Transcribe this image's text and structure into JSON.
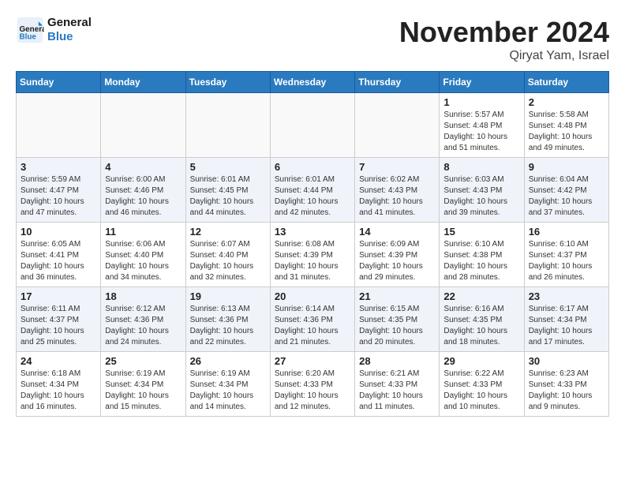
{
  "header": {
    "logo_line1": "General",
    "logo_line2": "Blue",
    "month": "November 2024",
    "location": "Qiryat Yam, Israel"
  },
  "weekdays": [
    "Sunday",
    "Monday",
    "Tuesday",
    "Wednesday",
    "Thursday",
    "Friday",
    "Saturday"
  ],
  "weeks": [
    [
      {
        "day": "",
        "content": ""
      },
      {
        "day": "",
        "content": ""
      },
      {
        "day": "",
        "content": ""
      },
      {
        "day": "",
        "content": ""
      },
      {
        "day": "",
        "content": ""
      },
      {
        "day": "1",
        "content": "Sunrise: 5:57 AM\nSunset: 4:48 PM\nDaylight: 10 hours\nand 51 minutes."
      },
      {
        "day": "2",
        "content": "Sunrise: 5:58 AM\nSunset: 4:48 PM\nDaylight: 10 hours\nand 49 minutes."
      }
    ],
    [
      {
        "day": "3",
        "content": "Sunrise: 5:59 AM\nSunset: 4:47 PM\nDaylight: 10 hours\nand 47 minutes."
      },
      {
        "day": "4",
        "content": "Sunrise: 6:00 AM\nSunset: 4:46 PM\nDaylight: 10 hours\nand 46 minutes."
      },
      {
        "day": "5",
        "content": "Sunrise: 6:01 AM\nSunset: 4:45 PM\nDaylight: 10 hours\nand 44 minutes."
      },
      {
        "day": "6",
        "content": "Sunrise: 6:01 AM\nSunset: 4:44 PM\nDaylight: 10 hours\nand 42 minutes."
      },
      {
        "day": "7",
        "content": "Sunrise: 6:02 AM\nSunset: 4:43 PM\nDaylight: 10 hours\nand 41 minutes."
      },
      {
        "day": "8",
        "content": "Sunrise: 6:03 AM\nSunset: 4:43 PM\nDaylight: 10 hours\nand 39 minutes."
      },
      {
        "day": "9",
        "content": "Sunrise: 6:04 AM\nSunset: 4:42 PM\nDaylight: 10 hours\nand 37 minutes."
      }
    ],
    [
      {
        "day": "10",
        "content": "Sunrise: 6:05 AM\nSunset: 4:41 PM\nDaylight: 10 hours\nand 36 minutes."
      },
      {
        "day": "11",
        "content": "Sunrise: 6:06 AM\nSunset: 4:40 PM\nDaylight: 10 hours\nand 34 minutes."
      },
      {
        "day": "12",
        "content": "Sunrise: 6:07 AM\nSunset: 4:40 PM\nDaylight: 10 hours\nand 32 minutes."
      },
      {
        "day": "13",
        "content": "Sunrise: 6:08 AM\nSunset: 4:39 PM\nDaylight: 10 hours\nand 31 minutes."
      },
      {
        "day": "14",
        "content": "Sunrise: 6:09 AM\nSunset: 4:39 PM\nDaylight: 10 hours\nand 29 minutes."
      },
      {
        "day": "15",
        "content": "Sunrise: 6:10 AM\nSunset: 4:38 PM\nDaylight: 10 hours\nand 28 minutes."
      },
      {
        "day": "16",
        "content": "Sunrise: 6:10 AM\nSunset: 4:37 PM\nDaylight: 10 hours\nand 26 minutes."
      }
    ],
    [
      {
        "day": "17",
        "content": "Sunrise: 6:11 AM\nSunset: 4:37 PM\nDaylight: 10 hours\nand 25 minutes."
      },
      {
        "day": "18",
        "content": "Sunrise: 6:12 AM\nSunset: 4:36 PM\nDaylight: 10 hours\nand 24 minutes."
      },
      {
        "day": "19",
        "content": "Sunrise: 6:13 AM\nSunset: 4:36 PM\nDaylight: 10 hours\nand 22 minutes."
      },
      {
        "day": "20",
        "content": "Sunrise: 6:14 AM\nSunset: 4:36 PM\nDaylight: 10 hours\nand 21 minutes."
      },
      {
        "day": "21",
        "content": "Sunrise: 6:15 AM\nSunset: 4:35 PM\nDaylight: 10 hours\nand 20 minutes."
      },
      {
        "day": "22",
        "content": "Sunrise: 6:16 AM\nSunset: 4:35 PM\nDaylight: 10 hours\nand 18 minutes."
      },
      {
        "day": "23",
        "content": "Sunrise: 6:17 AM\nSunset: 4:34 PM\nDaylight: 10 hours\nand 17 minutes."
      }
    ],
    [
      {
        "day": "24",
        "content": "Sunrise: 6:18 AM\nSunset: 4:34 PM\nDaylight: 10 hours\nand 16 minutes."
      },
      {
        "day": "25",
        "content": "Sunrise: 6:19 AM\nSunset: 4:34 PM\nDaylight: 10 hours\nand 15 minutes."
      },
      {
        "day": "26",
        "content": "Sunrise: 6:19 AM\nSunset: 4:34 PM\nDaylight: 10 hours\nand 14 minutes."
      },
      {
        "day": "27",
        "content": "Sunrise: 6:20 AM\nSunset: 4:33 PM\nDaylight: 10 hours\nand 12 minutes."
      },
      {
        "day": "28",
        "content": "Sunrise: 6:21 AM\nSunset: 4:33 PM\nDaylight: 10 hours\nand 11 minutes."
      },
      {
        "day": "29",
        "content": "Sunrise: 6:22 AM\nSunset: 4:33 PM\nDaylight: 10 hours\nand 10 minutes."
      },
      {
        "day": "30",
        "content": "Sunrise: 6:23 AM\nSunset: 4:33 PM\nDaylight: 10 hours\nand 9 minutes."
      }
    ]
  ]
}
